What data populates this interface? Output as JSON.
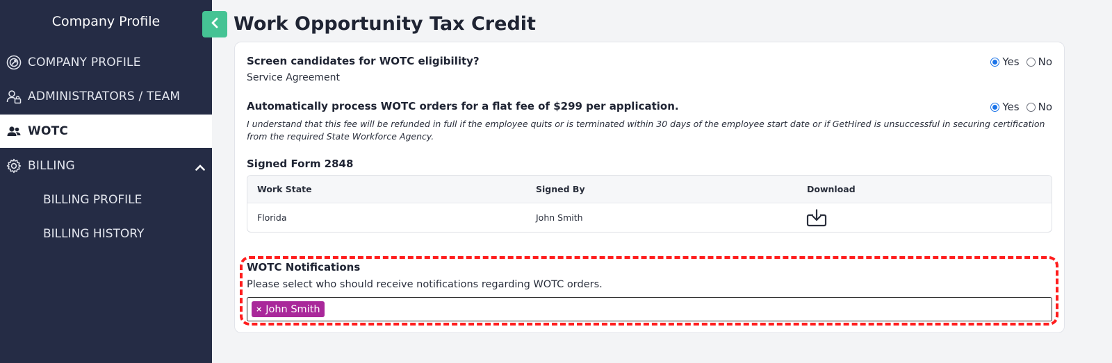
{
  "sidebar": {
    "title": "Company Profile",
    "items": [
      {
        "label": "COMPANY PROFILE",
        "icon": "target-icon"
      },
      {
        "label": "ADMINISTRATORS / TEAM",
        "icon": "users-lock-icon"
      },
      {
        "label": "WOTC",
        "icon": "user-group-icon",
        "active": true
      },
      {
        "label": "BILLING",
        "icon": "gear-icon",
        "expanded": true
      }
    ],
    "billing_sub": [
      {
        "label": "BILLING PROFILE"
      },
      {
        "label": "BILLING HISTORY"
      }
    ]
  },
  "page": {
    "title": "Work Opportunity Tax Credit"
  },
  "q1": {
    "title": "Screen candidates for WOTC eligibility?",
    "sub": "Service Agreement",
    "yes": "Yes",
    "no": "No",
    "selected": "Yes"
  },
  "q2": {
    "title": "Automatically process WOTC orders for a flat fee of $299 per application.",
    "disclaimer": "I understand that this fee will be refunded in full if the employee quits or is terminated within 30 days of the employee start date or if GetHired is unsuccessful in securing certification from the required State Workforce Agency.",
    "yes": "Yes",
    "no": "No",
    "selected": "Yes"
  },
  "signed_form": {
    "title": "Signed Form 2848",
    "columns": [
      "Work State",
      "Signed By",
      "Download"
    ],
    "rows": [
      {
        "work_state": "Florida",
        "signed_by": "John Smith",
        "download_icon": "download-icon"
      }
    ]
  },
  "notifications": {
    "title": "WOTC Notifications",
    "sub": "Please select who should receive notifications regarding WOTC orders.",
    "tag_remove": "×",
    "selected": [
      "John Smith"
    ]
  },
  "colors": {
    "sidebar_bg": "#252c45",
    "accent_green": "#45c394",
    "tag_purple": "#a9289a",
    "highlight_red": "#ff1d1d",
    "radio_blue": "#1a73e8"
  }
}
